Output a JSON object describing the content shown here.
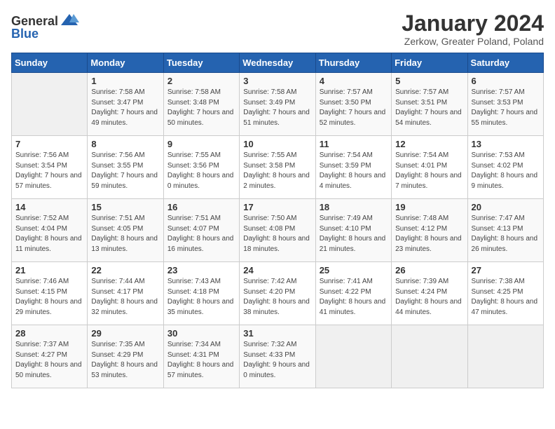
{
  "header": {
    "logo_general": "General",
    "logo_blue": "Blue",
    "title": "January 2024",
    "subtitle": "Zerkow, Greater Poland, Poland"
  },
  "weekdays": [
    "Sunday",
    "Monday",
    "Tuesday",
    "Wednesday",
    "Thursday",
    "Friday",
    "Saturday"
  ],
  "weeks": [
    [
      {
        "day": "",
        "sunrise": "",
        "sunset": "",
        "daylight": ""
      },
      {
        "day": "1",
        "sunrise": "Sunrise: 7:58 AM",
        "sunset": "Sunset: 3:47 PM",
        "daylight": "Daylight: 7 hours and 49 minutes."
      },
      {
        "day": "2",
        "sunrise": "Sunrise: 7:58 AM",
        "sunset": "Sunset: 3:48 PM",
        "daylight": "Daylight: 7 hours and 50 minutes."
      },
      {
        "day": "3",
        "sunrise": "Sunrise: 7:58 AM",
        "sunset": "Sunset: 3:49 PM",
        "daylight": "Daylight: 7 hours and 51 minutes."
      },
      {
        "day": "4",
        "sunrise": "Sunrise: 7:57 AM",
        "sunset": "Sunset: 3:50 PM",
        "daylight": "Daylight: 7 hours and 52 minutes."
      },
      {
        "day": "5",
        "sunrise": "Sunrise: 7:57 AM",
        "sunset": "Sunset: 3:51 PM",
        "daylight": "Daylight: 7 hours and 54 minutes."
      },
      {
        "day": "6",
        "sunrise": "Sunrise: 7:57 AM",
        "sunset": "Sunset: 3:53 PM",
        "daylight": "Daylight: 7 hours and 55 minutes."
      }
    ],
    [
      {
        "day": "7",
        "sunrise": "Sunrise: 7:56 AM",
        "sunset": "Sunset: 3:54 PM",
        "daylight": "Daylight: 7 hours and 57 minutes."
      },
      {
        "day": "8",
        "sunrise": "Sunrise: 7:56 AM",
        "sunset": "Sunset: 3:55 PM",
        "daylight": "Daylight: 7 hours and 59 minutes."
      },
      {
        "day": "9",
        "sunrise": "Sunrise: 7:55 AM",
        "sunset": "Sunset: 3:56 PM",
        "daylight": "Daylight: 8 hours and 0 minutes."
      },
      {
        "day": "10",
        "sunrise": "Sunrise: 7:55 AM",
        "sunset": "Sunset: 3:58 PM",
        "daylight": "Daylight: 8 hours and 2 minutes."
      },
      {
        "day": "11",
        "sunrise": "Sunrise: 7:54 AM",
        "sunset": "Sunset: 3:59 PM",
        "daylight": "Daylight: 8 hours and 4 minutes."
      },
      {
        "day": "12",
        "sunrise": "Sunrise: 7:54 AM",
        "sunset": "Sunset: 4:01 PM",
        "daylight": "Daylight: 8 hours and 7 minutes."
      },
      {
        "day": "13",
        "sunrise": "Sunrise: 7:53 AM",
        "sunset": "Sunset: 4:02 PM",
        "daylight": "Daylight: 8 hours and 9 minutes."
      }
    ],
    [
      {
        "day": "14",
        "sunrise": "Sunrise: 7:52 AM",
        "sunset": "Sunset: 4:04 PM",
        "daylight": "Daylight: 8 hours and 11 minutes."
      },
      {
        "day": "15",
        "sunrise": "Sunrise: 7:51 AM",
        "sunset": "Sunset: 4:05 PM",
        "daylight": "Daylight: 8 hours and 13 minutes."
      },
      {
        "day": "16",
        "sunrise": "Sunrise: 7:51 AM",
        "sunset": "Sunset: 4:07 PM",
        "daylight": "Daylight: 8 hours and 16 minutes."
      },
      {
        "day": "17",
        "sunrise": "Sunrise: 7:50 AM",
        "sunset": "Sunset: 4:08 PM",
        "daylight": "Daylight: 8 hours and 18 minutes."
      },
      {
        "day": "18",
        "sunrise": "Sunrise: 7:49 AM",
        "sunset": "Sunset: 4:10 PM",
        "daylight": "Daylight: 8 hours and 21 minutes."
      },
      {
        "day": "19",
        "sunrise": "Sunrise: 7:48 AM",
        "sunset": "Sunset: 4:12 PM",
        "daylight": "Daylight: 8 hours and 23 minutes."
      },
      {
        "day": "20",
        "sunrise": "Sunrise: 7:47 AM",
        "sunset": "Sunset: 4:13 PM",
        "daylight": "Daylight: 8 hours and 26 minutes."
      }
    ],
    [
      {
        "day": "21",
        "sunrise": "Sunrise: 7:46 AM",
        "sunset": "Sunset: 4:15 PM",
        "daylight": "Daylight: 8 hours and 29 minutes."
      },
      {
        "day": "22",
        "sunrise": "Sunrise: 7:44 AM",
        "sunset": "Sunset: 4:17 PM",
        "daylight": "Daylight: 8 hours and 32 minutes."
      },
      {
        "day": "23",
        "sunrise": "Sunrise: 7:43 AM",
        "sunset": "Sunset: 4:18 PM",
        "daylight": "Daylight: 8 hours and 35 minutes."
      },
      {
        "day": "24",
        "sunrise": "Sunrise: 7:42 AM",
        "sunset": "Sunset: 4:20 PM",
        "daylight": "Daylight: 8 hours and 38 minutes."
      },
      {
        "day": "25",
        "sunrise": "Sunrise: 7:41 AM",
        "sunset": "Sunset: 4:22 PM",
        "daylight": "Daylight: 8 hours and 41 minutes."
      },
      {
        "day": "26",
        "sunrise": "Sunrise: 7:39 AM",
        "sunset": "Sunset: 4:24 PM",
        "daylight": "Daylight: 8 hours and 44 minutes."
      },
      {
        "day": "27",
        "sunrise": "Sunrise: 7:38 AM",
        "sunset": "Sunset: 4:25 PM",
        "daylight": "Daylight: 8 hours and 47 minutes."
      }
    ],
    [
      {
        "day": "28",
        "sunrise": "Sunrise: 7:37 AM",
        "sunset": "Sunset: 4:27 PM",
        "daylight": "Daylight: 8 hours and 50 minutes."
      },
      {
        "day": "29",
        "sunrise": "Sunrise: 7:35 AM",
        "sunset": "Sunset: 4:29 PM",
        "daylight": "Daylight: 8 hours and 53 minutes."
      },
      {
        "day": "30",
        "sunrise": "Sunrise: 7:34 AM",
        "sunset": "Sunset: 4:31 PM",
        "daylight": "Daylight: 8 hours and 57 minutes."
      },
      {
        "day": "31",
        "sunrise": "Sunrise: 7:32 AM",
        "sunset": "Sunset: 4:33 PM",
        "daylight": "Daylight: 9 hours and 0 minutes."
      },
      {
        "day": "",
        "sunrise": "",
        "sunset": "",
        "daylight": ""
      },
      {
        "day": "",
        "sunrise": "",
        "sunset": "",
        "daylight": ""
      },
      {
        "day": "",
        "sunrise": "",
        "sunset": "",
        "daylight": ""
      }
    ]
  ]
}
